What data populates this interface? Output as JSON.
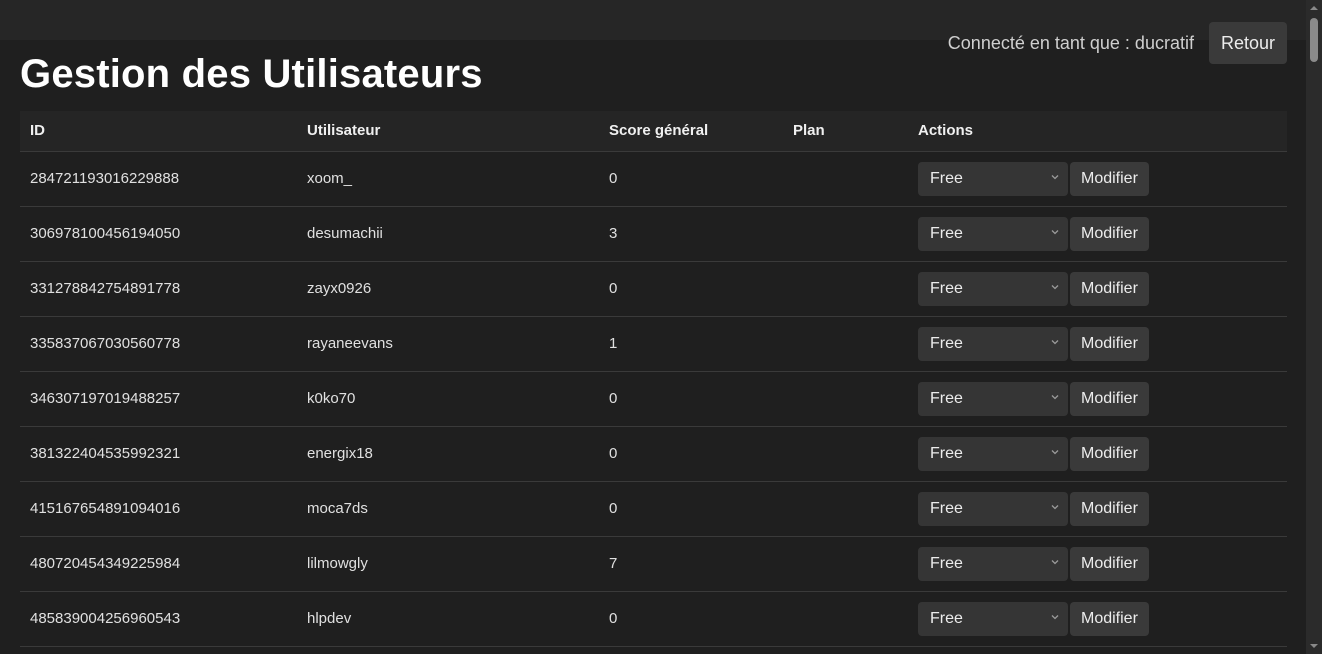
{
  "header": {
    "connected_text": "Connecté en tant que : ducratif",
    "back_label": "Retour"
  },
  "page_title": "Gestion des Utilisateurs",
  "table": {
    "columns": [
      "ID",
      "Utilisateur",
      "Score général",
      "Plan",
      "Actions"
    ],
    "rows": [
      {
        "id": "284721193016229888",
        "user": "xoom_",
        "score": "0",
        "plan": "",
        "plan_select": "Free",
        "action": "Modifier"
      },
      {
        "id": "306978100456194050",
        "user": "desumachii",
        "score": "3",
        "plan": "",
        "plan_select": "Free",
        "action": "Modifier"
      },
      {
        "id": "331278842754891778",
        "user": "zayx0926",
        "score": "0",
        "plan": "",
        "plan_select": "Free",
        "action": "Modifier"
      },
      {
        "id": "335837067030560778",
        "user": "rayaneevans",
        "score": "1",
        "plan": "",
        "plan_select": "Free",
        "action": "Modifier"
      },
      {
        "id": "346307197019488257",
        "user": "k0ko70",
        "score": "0",
        "plan": "",
        "plan_select": "Free",
        "action": "Modifier"
      },
      {
        "id": "381322404535992321",
        "user": "energix18",
        "score": "0",
        "plan": "",
        "plan_select": "Free",
        "action": "Modifier"
      },
      {
        "id": "415167654891094016",
        "user": "moca7ds",
        "score": "0",
        "plan": "",
        "plan_select": "Free",
        "action": "Modifier"
      },
      {
        "id": "480720454349225984",
        "user": "lilmowgly",
        "score": "7",
        "plan": "",
        "plan_select": "Free",
        "action": "Modifier"
      },
      {
        "id": "485839004256960543",
        "user": "hlpdev",
        "score": "0",
        "plan": "",
        "plan_select": "Free",
        "action": "Modifier"
      }
    ]
  },
  "icons": {
    "select_chevron": "chevron-down-icon",
    "scroll_up": "scroll-up-arrow-icon",
    "scroll_down": "scroll-down-arrow-icon"
  },
  "colors": {
    "background": "#1f1f1f",
    "header_bar": "#262626",
    "button": "#3a3a3a",
    "select": "#353535",
    "border": "#3a3a3a"
  }
}
